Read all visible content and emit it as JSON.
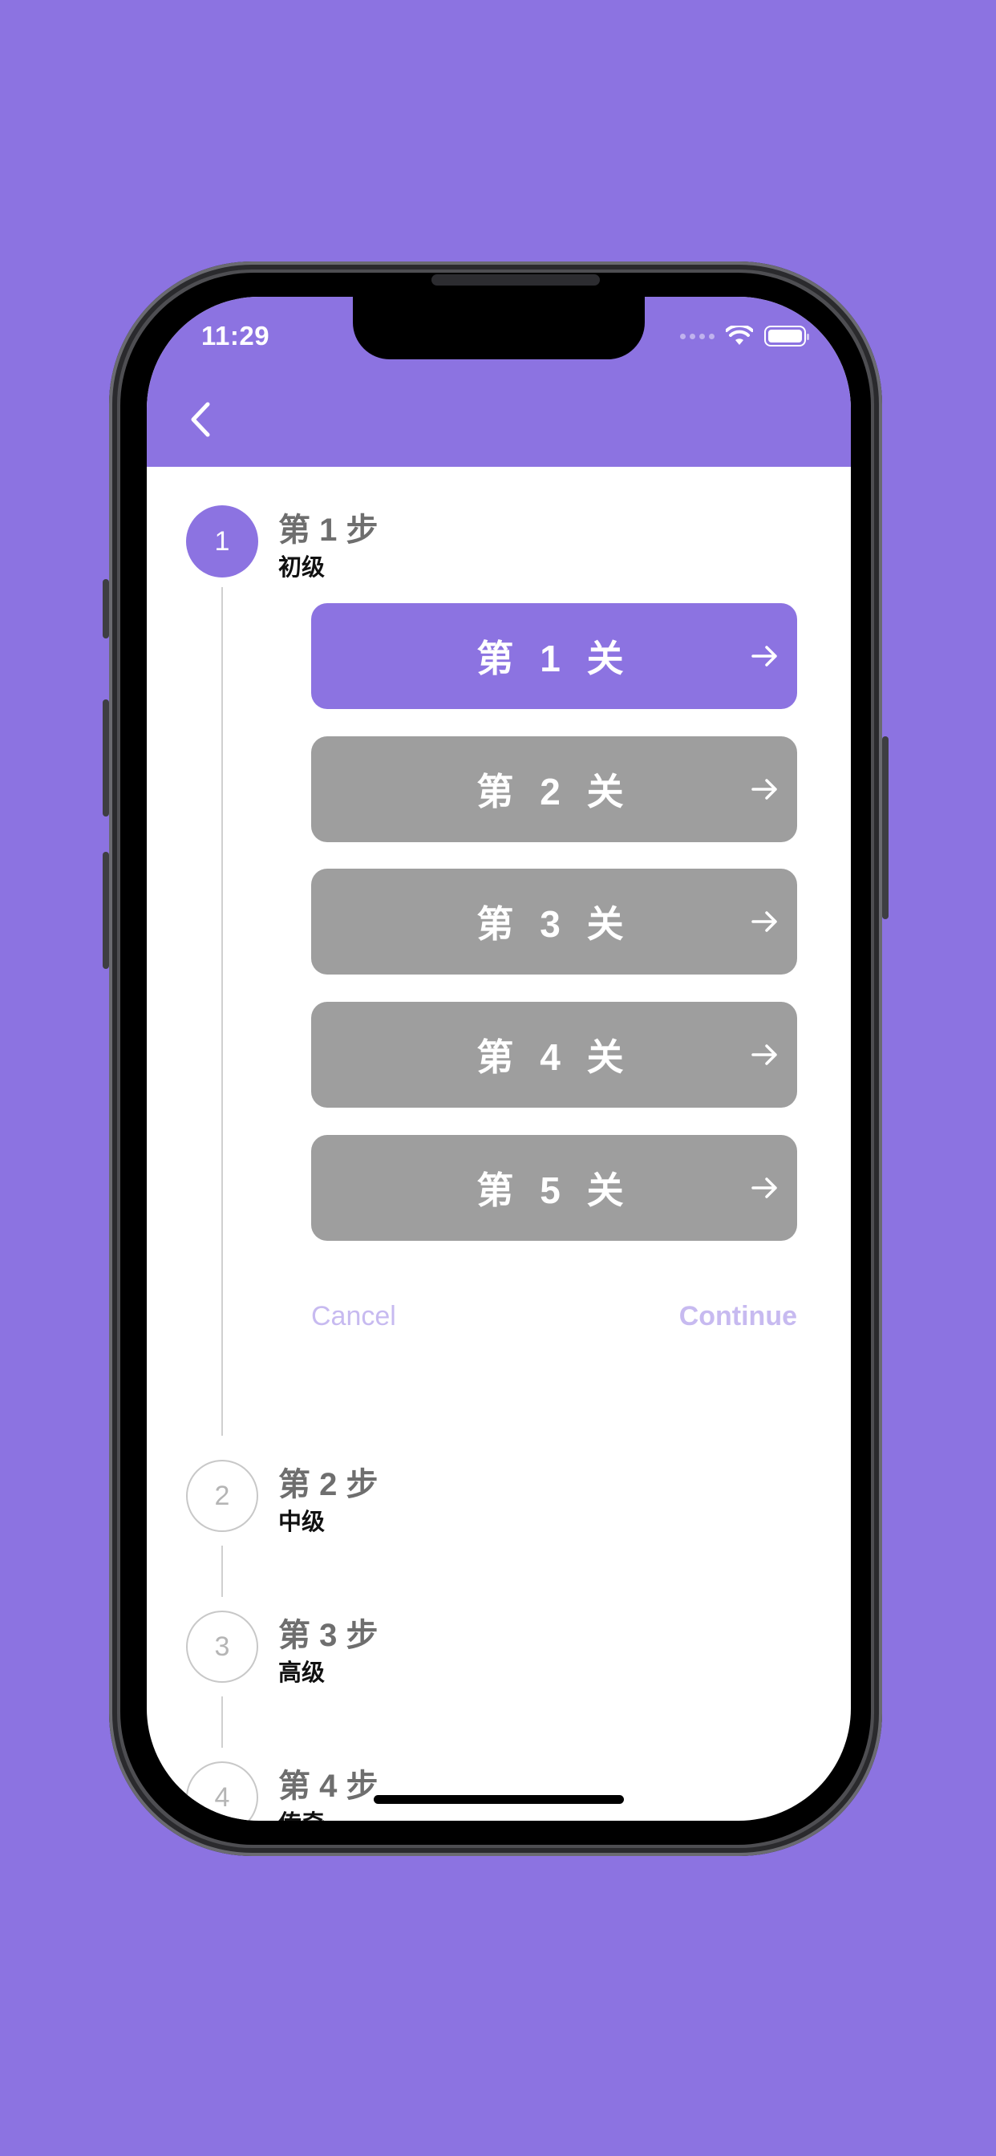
{
  "status_bar": {
    "time": "11:29"
  },
  "colors": {
    "accent": "#8C73E1",
    "locked": "#9E9E9E",
    "muted_action": "#C7BAF0"
  },
  "nav": {
    "back_icon": "chevron-left-icon"
  },
  "steps": [
    {
      "number": "1",
      "title": "第 1 步",
      "subtitle": "初级"
    },
    {
      "number": "2",
      "title": "第 2 步",
      "subtitle": "中级"
    },
    {
      "number": "3",
      "title": "第 3 步",
      "subtitle": "高级"
    },
    {
      "number": "4",
      "title": "第 4 步",
      "subtitle": "传奇"
    }
  ],
  "levels": [
    {
      "label": "第 1 关",
      "state": "active"
    },
    {
      "label": "第 2 关",
      "state": "locked"
    },
    {
      "label": "第 3 关",
      "state": "locked"
    },
    {
      "label": "第 4 关",
      "state": "locked"
    },
    {
      "label": "第 5 关",
      "state": "locked"
    }
  ],
  "actions": {
    "cancel": "Cancel",
    "continue": "Continue"
  }
}
